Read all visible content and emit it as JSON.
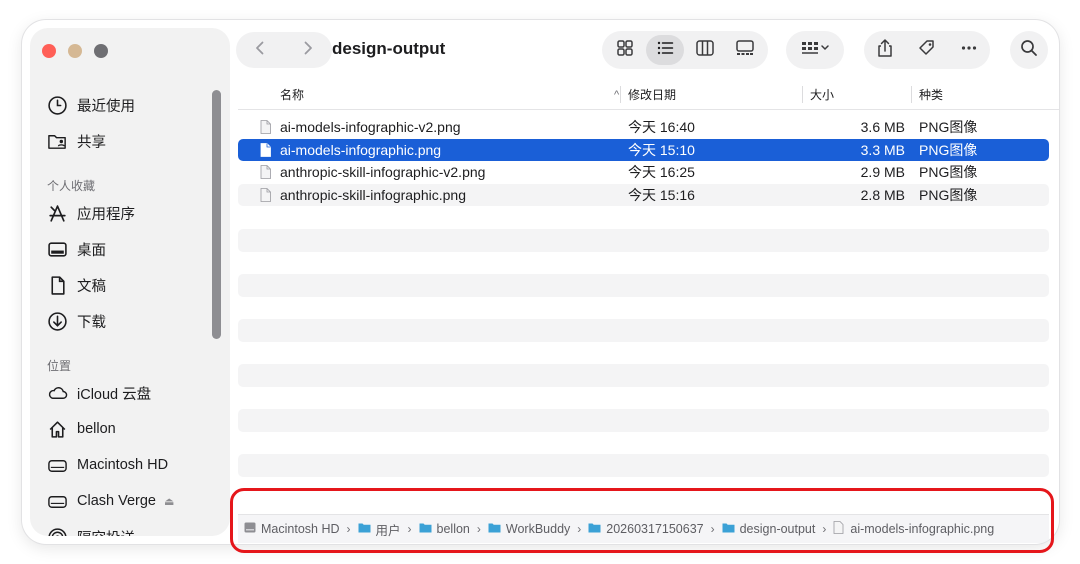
{
  "window": {
    "title": "design-output"
  },
  "sidebar": {
    "top_items": [
      {
        "label": "最近使用",
        "icon": "clock-icon"
      },
      {
        "label": "共享",
        "icon": "shared-folder-icon"
      }
    ],
    "favorites_header": "个人收藏",
    "favorites": [
      {
        "label": "应用程序",
        "icon": "applications-icon"
      },
      {
        "label": "桌面",
        "icon": "desktop-icon"
      },
      {
        "label": "文稿",
        "icon": "document-icon"
      },
      {
        "label": "下载",
        "icon": "download-icon"
      }
    ],
    "locations_header": "位置",
    "locations": [
      {
        "label": "iCloud 云盘",
        "icon": "cloud-icon"
      },
      {
        "label": "bellon",
        "icon": "home-icon"
      },
      {
        "label": "Macintosh HD",
        "icon": "hard-drive-icon"
      },
      {
        "label": "Clash Verge",
        "icon": "external-drive-icon",
        "eject": "⏏"
      },
      {
        "label": "隔空投送",
        "icon": "airdrop-icon"
      }
    ]
  },
  "toolbar": {
    "back_icon": "chevron-left-icon",
    "forward_icon": "chevron-right-icon",
    "view_modes": [
      "icon-view-icon",
      "list-view-icon",
      "column-view-icon",
      "gallery-view-icon"
    ],
    "active_view": "list-view-icon",
    "group_icon": "group-by-icon",
    "actions": [
      "share-icon",
      "tag-icon",
      "more-icon"
    ],
    "search_icon": "search-icon"
  },
  "columns": {
    "name": "名称",
    "date": "修改日期",
    "size": "大小",
    "kind": "种类",
    "sort_indicator": "^"
  },
  "files": [
    {
      "name": "ai-models-infographic-v2.png",
      "date": "今天 16:40",
      "size": "3.6 MB",
      "kind": "PNG图像",
      "selected": false
    },
    {
      "name": "ai-models-infographic.png",
      "date": "今天 15:10",
      "size": "3.3 MB",
      "kind": "PNG图像",
      "selected": true
    },
    {
      "name": "anthropic-skill-infographic-v2.png",
      "date": "今天 16:25",
      "size": "2.9 MB",
      "kind": "PNG图像",
      "selected": false
    },
    {
      "name": "anthropic-skill-infographic.png",
      "date": "今天 15:16",
      "size": "2.8 MB",
      "kind": "PNG图像",
      "selected": false
    }
  ],
  "path_bar": {
    "segments": [
      {
        "label": "Macintosh HD",
        "icon": "hard-drive-icon"
      },
      {
        "label": "用户",
        "icon": "folder-icon"
      },
      {
        "label": "bellon",
        "icon": "folder-icon"
      },
      {
        "label": "WorkBuddy",
        "icon": "folder-icon"
      },
      {
        "label": "20260317150637",
        "icon": "folder-icon"
      },
      {
        "label": "design-output",
        "icon": "folder-icon"
      },
      {
        "label": "ai-models-infographic.png",
        "icon": "file-icon"
      }
    ],
    "separator": "›"
  },
  "colors": {
    "selection": "#1a5fd7",
    "highlight_border": "#e5161b",
    "folder": "#3ba1d6",
    "close": "#ff5f57"
  }
}
